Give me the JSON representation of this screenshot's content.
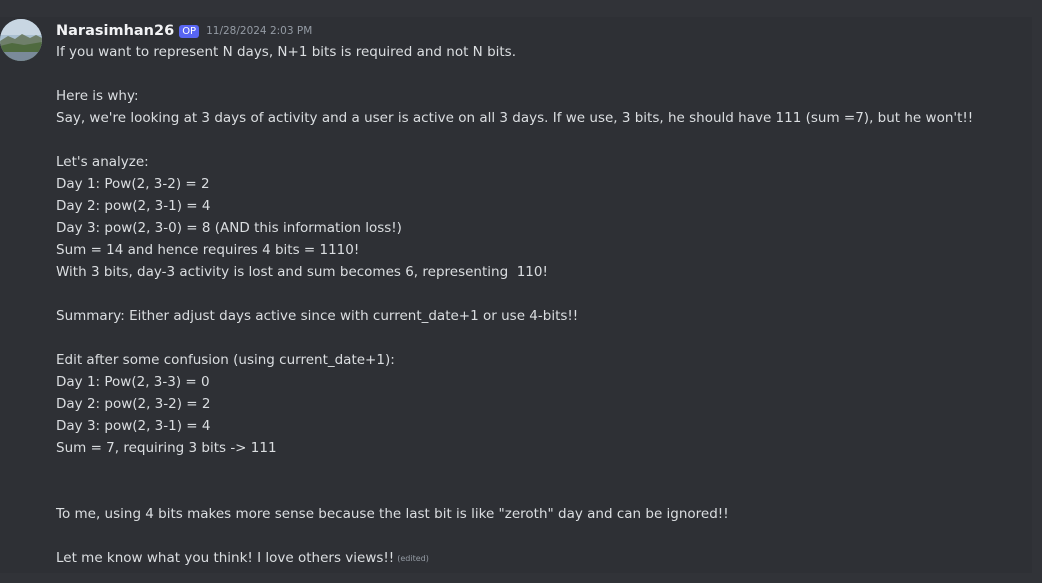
{
  "message": {
    "username": "Narasimhan26",
    "badge": "OP",
    "timestamp": "11/28/2024 2:03 PM",
    "lines": [
      "If you want to represent N days, N+1 bits is required and not N bits.",
      "",
      "Here is why:",
      "Say, we're looking at 3 days of activity and a user is active on all 3 days. If we use, 3 bits, he should have 111 (sum =7), but he won't!!",
      "",
      "Let's analyze:",
      "Day 1: Pow(2, 3-2) = 2",
      "Day 2: pow(2, 3-1) = 4",
      "Day 3: pow(2, 3-0) = 8 (AND this information loss!)",
      "Sum = 14 and hence requires 4 bits = 1110!",
      "With 3 bits, day-3 activity is lost and sum becomes 6, representing  110!",
      "",
      "Summary: Either adjust days active since with current_date+1 or use 4-bits!!",
      "",
      "Edit after some confusion (using current_date+1):",
      "Day 1: Pow(2, 3-3) = 0",
      "Day 2: pow(2, 3-2) = 2",
      "Day 3: pow(2, 3-1) = 4",
      "Sum = 7, requiring 3 bits -> 111",
      "",
      "",
      "To me, using 4 bits makes more sense because the last bit is like \"zeroth\" day and can be ignored!!",
      "",
      "Let me know what you think! I love others views!!"
    ],
    "edited_label": "(edited)"
  },
  "colors": {
    "background": "#313338",
    "message_hover": "#2e3035",
    "badge": "#5865f2",
    "text": "#dbdee1",
    "muted": "#949ba4"
  },
  "icons": {
    "avatar": "avatar-landscape-photo"
  }
}
